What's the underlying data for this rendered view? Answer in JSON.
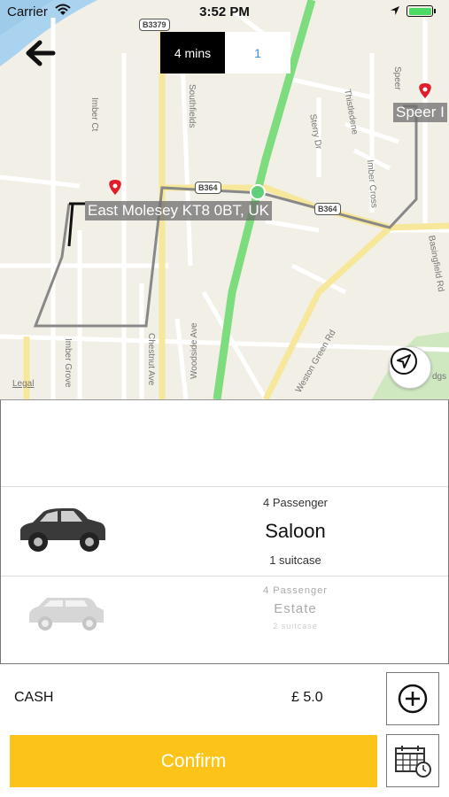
{
  "status_bar": {
    "carrier": "Carrier",
    "time": "3:52 PM"
  },
  "map": {
    "eta_minutes": "4 mins",
    "eta_count": "1",
    "pickup_label": "East Molesey KT8 0BT, UK",
    "destination_label": "Speer I",
    "legal": "Legal",
    "route_color": "#888888",
    "main_road_color": "#7ddc7d",
    "streets": [
      "B3379",
      "Southfields",
      "Imber Ct",
      "Sterry Dr",
      "Thistledene",
      "Speer",
      "Imber Cross",
      "B364",
      "B364",
      "Basingfield Rd",
      "Weston Green Rd",
      "Imber Grove",
      "Chestnut Ave",
      "Woodside Ave",
      "dgs"
    ]
  },
  "vehicles": [
    {
      "passengers": "4 Passenger",
      "name": "Saloon",
      "luggage": "1 suitcase",
      "selected": true
    },
    {
      "passengers": "4 Passenger",
      "name": "Estate",
      "luggage": "2 suitcase",
      "selected": false
    }
  ],
  "payment": {
    "method": "CASH",
    "price": "£ 5.0"
  },
  "actions": {
    "confirm_label": "Confirm",
    "confirm_color": "#fcc419"
  },
  "icons": {
    "back": "arrow-left-icon",
    "locate": "navigation-arrow-icon",
    "add": "plus-circle-icon",
    "schedule": "calendar-clock-icon",
    "pin": "map-pin-icon"
  }
}
